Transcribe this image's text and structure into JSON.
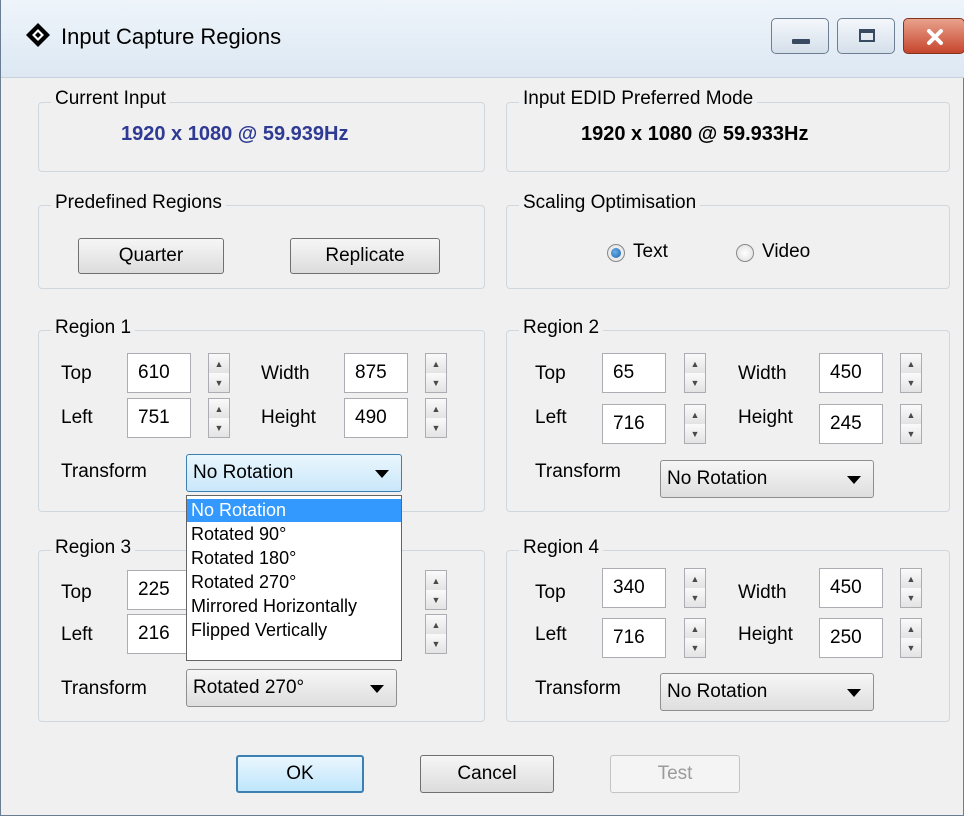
{
  "window": {
    "title": "Input Capture Regions",
    "controls": [
      "minimize-icon",
      "maximize-icon",
      "close-icon"
    ]
  },
  "current_input": {
    "label": "Current Input",
    "value": "1920 x 1080 @ 59.939Hz",
    "value_color": "#2e3a93"
  },
  "edid_mode": {
    "label": "Input EDID Preferred Mode",
    "value": "1920 x 1080 @ 59.933Hz"
  },
  "predefined": {
    "label": "Predefined Regions",
    "quarter": "Quarter",
    "replicate": "Replicate"
  },
  "scaling": {
    "label": "Scaling Optimisation",
    "text": "Text",
    "video": "Video",
    "selected": "Text"
  },
  "labels": {
    "top": "Top",
    "left": "Left",
    "width": "Width",
    "height": "Height",
    "transform": "Transform"
  },
  "regions": [
    {
      "label": "Region 1",
      "top": "610",
      "left": "751",
      "width": "875",
      "height": "490",
      "transform": "No Rotation"
    },
    {
      "label": "Region 2",
      "top": "65",
      "left": "716",
      "width": "450",
      "height": "245",
      "transform": "No Rotation"
    },
    {
      "label": "Region 3",
      "top": "225",
      "left": "216",
      "transform": "Rotated 270°"
    },
    {
      "label": "Region 4",
      "top": "340",
      "left": "716",
      "width": "450",
      "height": "250",
      "transform": "No Rotation"
    }
  ],
  "dropdown": {
    "options": [
      "No Rotation",
      "Rotated 90°",
      "Rotated 180°",
      "Rotated 270°",
      "Mirrored Horizontally",
      "Flipped Vertically"
    ],
    "highlighted": "No Rotation"
  },
  "buttons": {
    "ok": "OK",
    "cancel": "Cancel",
    "test": "Test"
  },
  "colors": {
    "highlight": "#3399ff",
    "title_gradient_top": "#eef4fa",
    "close_button": "#c7452d"
  }
}
